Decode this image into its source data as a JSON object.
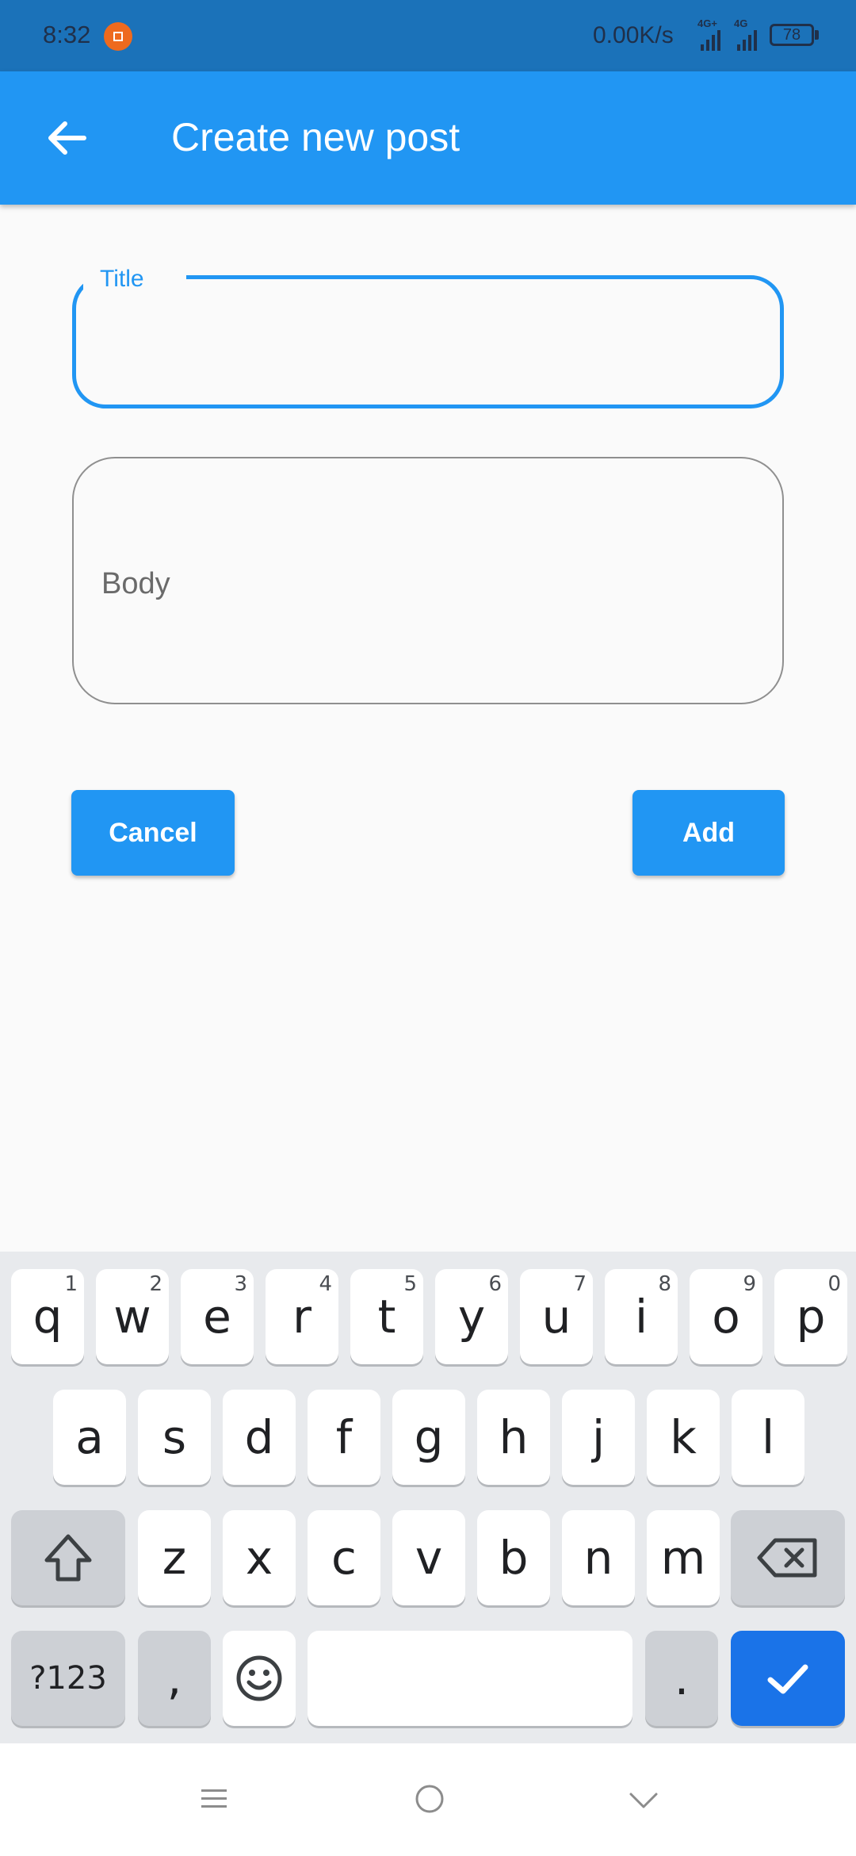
{
  "status_bar": {
    "time": "8:32",
    "net_speed": "0.00K/s",
    "signal_1": "4G+",
    "signal_2": "4G",
    "battery": "78"
  },
  "app_bar": {
    "title": "Create new post",
    "back_icon": "arrow-left-icon"
  },
  "form": {
    "title_label": "Title",
    "title_value": "",
    "body_placeholder": "Body",
    "body_value": ""
  },
  "actions": {
    "cancel_label": "Cancel",
    "add_label": "Add"
  },
  "keyboard": {
    "row1": [
      {
        "k": "q",
        "h": "1"
      },
      {
        "k": "w",
        "h": "2"
      },
      {
        "k": "e",
        "h": "3"
      },
      {
        "k": "r",
        "h": "4"
      },
      {
        "k": "t",
        "h": "5"
      },
      {
        "k": "y",
        "h": "6"
      },
      {
        "k": "u",
        "h": "7"
      },
      {
        "k": "i",
        "h": "8"
      },
      {
        "k": "o",
        "h": "9"
      },
      {
        "k": "p",
        "h": "0"
      }
    ],
    "row2": [
      "a",
      "s",
      "d",
      "f",
      "g",
      "h",
      "j",
      "k",
      "l"
    ],
    "row3": [
      "z",
      "x",
      "c",
      "v",
      "b",
      "n",
      "m"
    ],
    "symbols_label": "?123",
    "comma": ",",
    "period": "."
  },
  "colors": {
    "primary": "#2196f3",
    "status_bar": "#1b72b9",
    "enter_key": "#1a73e8"
  }
}
